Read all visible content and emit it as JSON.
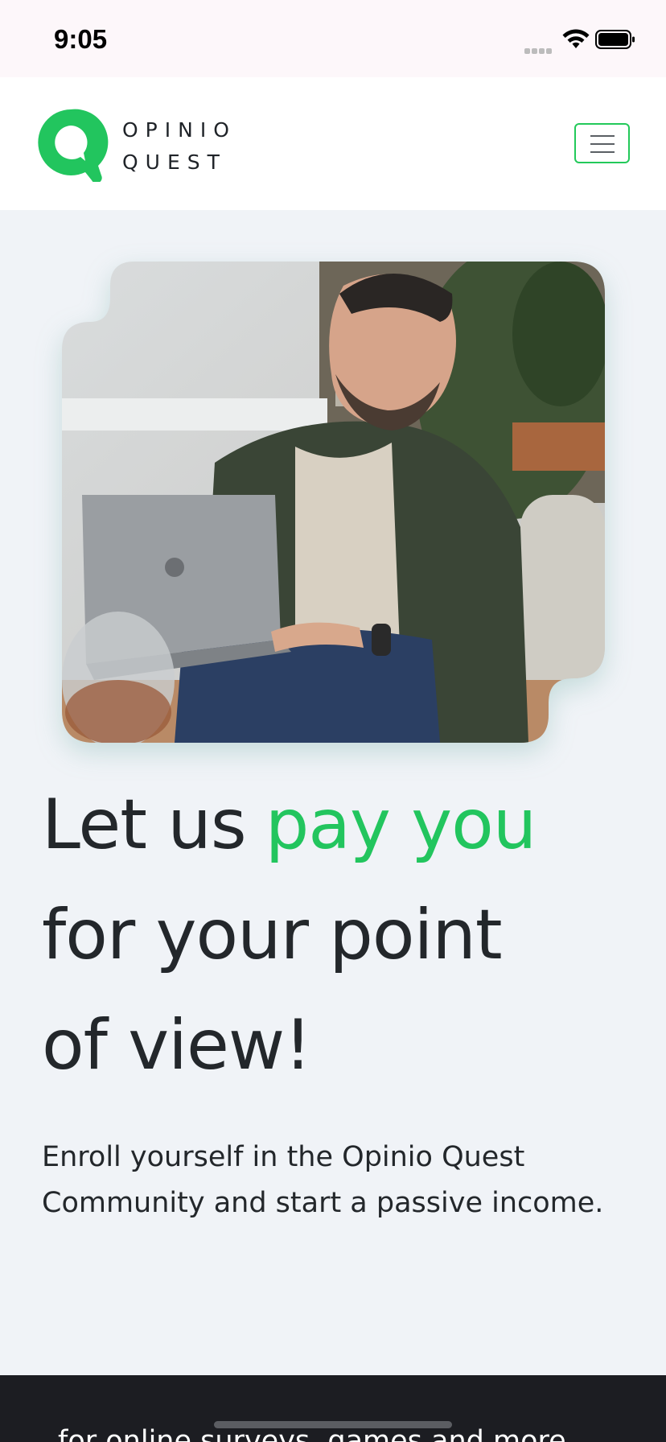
{
  "status_bar": {
    "time": "9:05"
  },
  "brand": {
    "line1": "OPINIO",
    "line2": "QUEST",
    "accent_color": "#22c55e"
  },
  "nav": {
    "menu_icon": "hamburger-menu-icon"
  },
  "hero": {
    "headline_part1": "Let us",
    "headline_accent": "pay you",
    "headline_part2": "for your point",
    "headline_part3": "of view!",
    "subtext": "Enroll yourself in the Opinio Quest Community and start a passive income."
  },
  "next_section": {
    "text": "for online surveys, games and more"
  }
}
